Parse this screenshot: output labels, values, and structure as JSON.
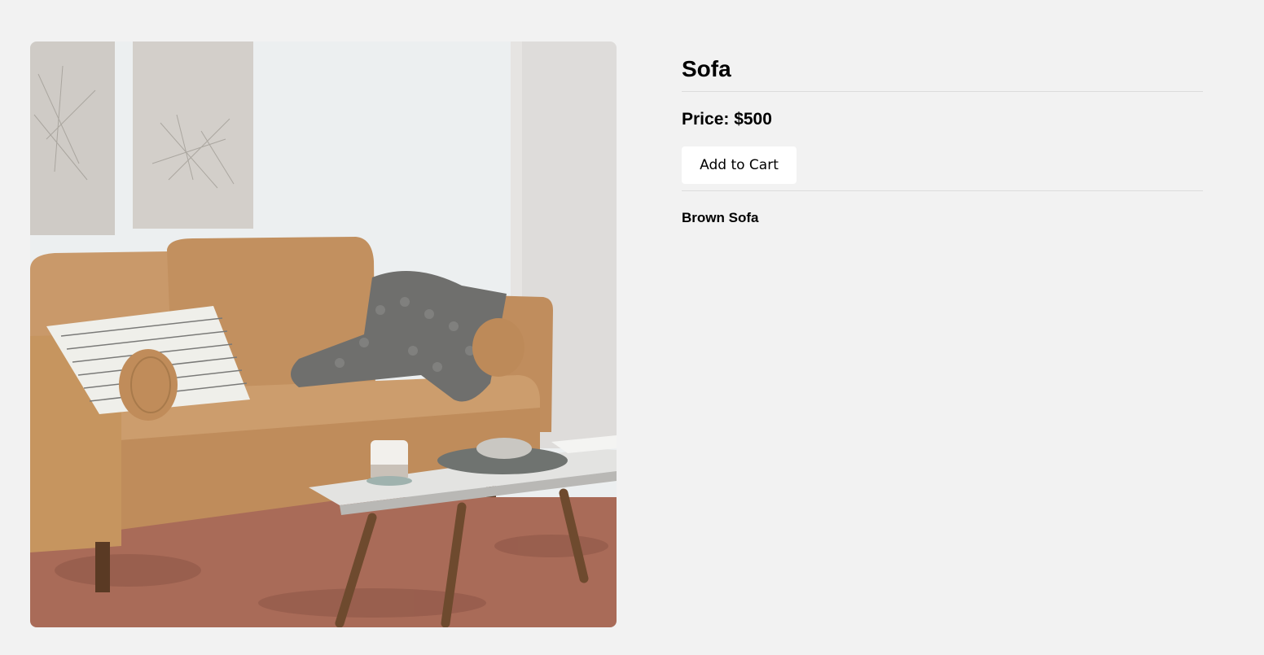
{
  "product": {
    "title": "Sofa",
    "price": "Price: $500",
    "add_to_cart_label": "Add to Cart",
    "description": "Brown Sofa",
    "image_alt": "Brown leather sofa with pillows, grey knit throw and a marble coffee table"
  },
  "colors": {
    "background": "#f2f2f2",
    "button_background": "#ffffff",
    "divider": "#dcdcdc",
    "sofa_leather": "#c89a66",
    "rug": "#b0705a"
  }
}
